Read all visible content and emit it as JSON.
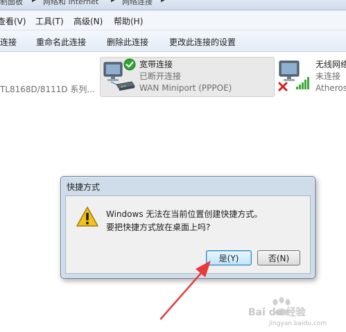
{
  "breadcrumb": {
    "items": [
      "制面板",
      "网络和 Internet",
      "网络连接"
    ]
  },
  "menubar": {
    "items": [
      "查看(V)",
      "工具(T)",
      "高级(N)",
      "帮助(H)"
    ]
  },
  "toolbar": {
    "items": [
      "连接",
      "重命名此连接",
      "删除此连接",
      "更改此连接的设置"
    ]
  },
  "adapters": {
    "left": {
      "device": "TL8168D/8111D 系列..."
    },
    "broadband": {
      "name": "宽带连接",
      "status": "已断开连接",
      "device": "WAN Miniport (PPPOE)"
    },
    "wireless": {
      "name": "无线网络",
      "status": "未连接",
      "device": "Atheros"
    }
  },
  "dialog": {
    "title": "快捷方式",
    "line1": "Windows 无法在当前位置创建快捷方式。",
    "line2": "要把快捷方式放在桌面上吗?",
    "yes_label": "是(Y)",
    "no_label": "否(N)"
  },
  "watermark": {
    "text": "Bai du 经验",
    "url": "jingyan.baidu.com"
  },
  "colors": {
    "annotation_arrow": "#e8393a",
    "warning": "#f2c21b",
    "connected_check": "#2fa32f",
    "error_x": "#d6201f",
    "signal": "#3aa93a"
  }
}
